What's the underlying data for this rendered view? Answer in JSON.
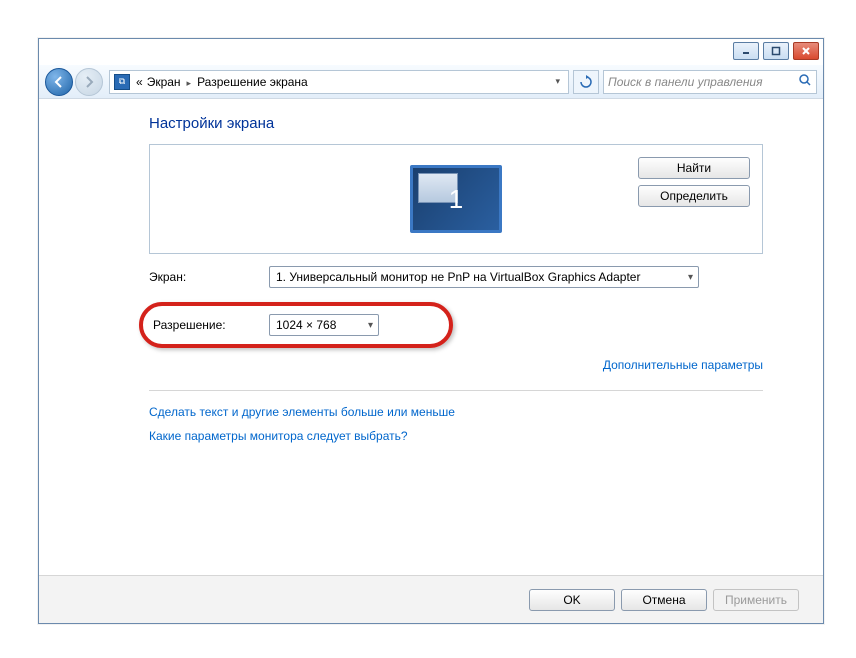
{
  "breadcrumb": {
    "item1": "Экран",
    "item2": "Разрешение экрана",
    "prefix": "«"
  },
  "search": {
    "placeholder": "Поиск в панели управления"
  },
  "page_title": "Настройки экрана",
  "panel": {
    "find": "Найти",
    "identify": "Определить",
    "monitor_number": "1"
  },
  "rows": {
    "screen_label": "Экран:",
    "screen_value": "1. Универсальный монитор не PnP на VirtualBox Graphics Adapter",
    "resolution_label": "Разрешение:",
    "resolution_value": "1024 × 768"
  },
  "links": {
    "advanced": "Дополнительные параметры",
    "textsize": "Сделать текст и другие элементы больше или меньше",
    "which": "Какие параметры монитора следует выбрать?"
  },
  "footer": {
    "ok": "OK",
    "cancel": "Отмена",
    "apply": "Применить"
  }
}
